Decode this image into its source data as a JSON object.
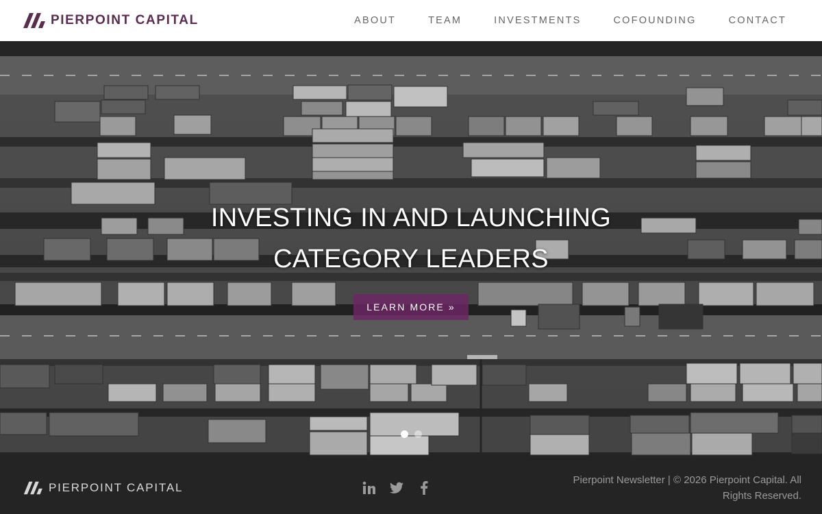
{
  "brand": {
    "name": "PIERPOINT CAPITAL",
    "accent_color": "#5a2d4f"
  },
  "nav": {
    "items": [
      {
        "label": "ABOUT"
      },
      {
        "label": "TEAM"
      },
      {
        "label": "INVESTMENTS"
      },
      {
        "label": "COFOUNDING"
      },
      {
        "label": "CONTACT"
      }
    ]
  },
  "hero": {
    "title_line1": "INVESTING IN AND LAUNCHING",
    "title_line2": "CATEGORY LEADERS",
    "cta_label": "LEARN MORE »",
    "cta_color": "#6e2664",
    "image_description_icon": "container-port-photo",
    "slides": {
      "count": 2,
      "active": 1
    }
  },
  "footer": {
    "brand_name": "PIERPOINT CAPITAL",
    "social": [
      "linkedin-icon",
      "twitter-icon",
      "facebook-icon"
    ],
    "newsletter_label": "Pierpoint Newsletter",
    "separator": " | ",
    "copyright": "© 2026 Pierpoint Capital. All Rights Reserved."
  }
}
